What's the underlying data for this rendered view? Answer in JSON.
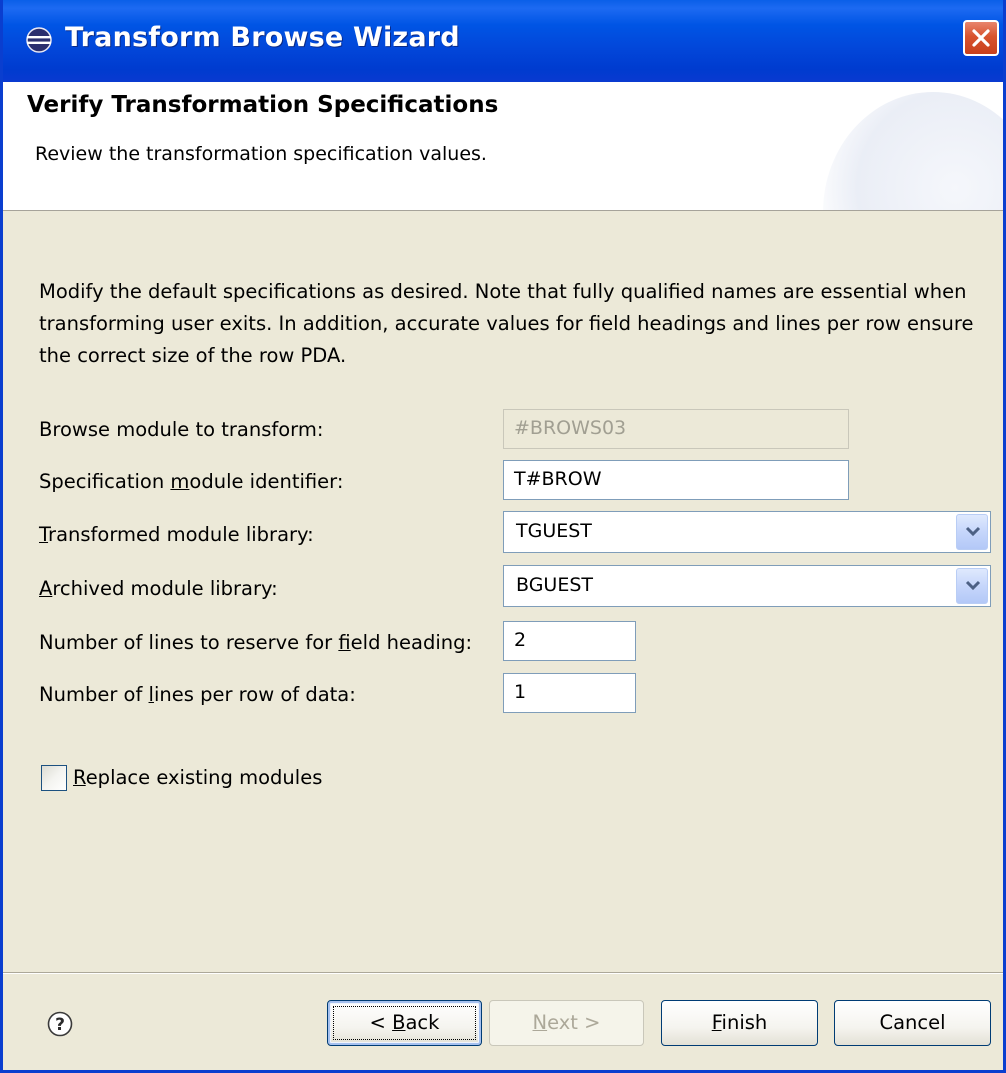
{
  "window": {
    "title": "Transform Browse Wizard",
    "icon": "eclipse-icon",
    "title_bar_color": "#0055e5",
    "close_icon": "close-icon"
  },
  "header": {
    "title": "Verify Transformation Specifications",
    "description": "Review the transformation specification values."
  },
  "intro": {
    "text": "Modify the default specifications as desired.  Note that fully qualified names are essential when transforming user exits.  In addition, accurate values for field headings and lines per row ensure the correct size of the row PDA."
  },
  "fields": {
    "browse_module": {
      "label": "Browse module to transform:",
      "value": "#BROWS03",
      "enabled": false
    },
    "spec_module_id": {
      "label_pre": "Specification ",
      "label_mnemonic": "m",
      "label_post": "odule identifier:",
      "value": "T#BROW"
    },
    "transformed_library": {
      "label_mnemonic": "T",
      "label_post": "ransformed module library:",
      "value": "TGUEST"
    },
    "archived_library": {
      "label_mnemonic": "A",
      "label_post": "rchived module library:",
      "value": "BGUEST"
    },
    "heading_lines": {
      "label_pre": "Number of lines to reserve for ",
      "label_mnemonic": "f",
      "label_post": "ield heading:",
      "value": "2"
    },
    "row_lines": {
      "label_pre": "Number of ",
      "label_mnemonic": "l",
      "label_post": "ines per row of data:",
      "value": "1"
    }
  },
  "replace_existing": {
    "label_mnemonic": "R",
    "label_post": "eplace existing modules",
    "checked": false
  },
  "buttons": {
    "help_icon": "help-icon",
    "back": {
      "label_pre": "< ",
      "label_mnemonic": "B",
      "label_post": "ack"
    },
    "next": {
      "label_mnemonic": "N",
      "label_post": "ext >",
      "enabled": false
    },
    "finish": {
      "label_mnemonic": "F",
      "label_post": "inish"
    },
    "cancel": {
      "label": "Cancel"
    }
  }
}
